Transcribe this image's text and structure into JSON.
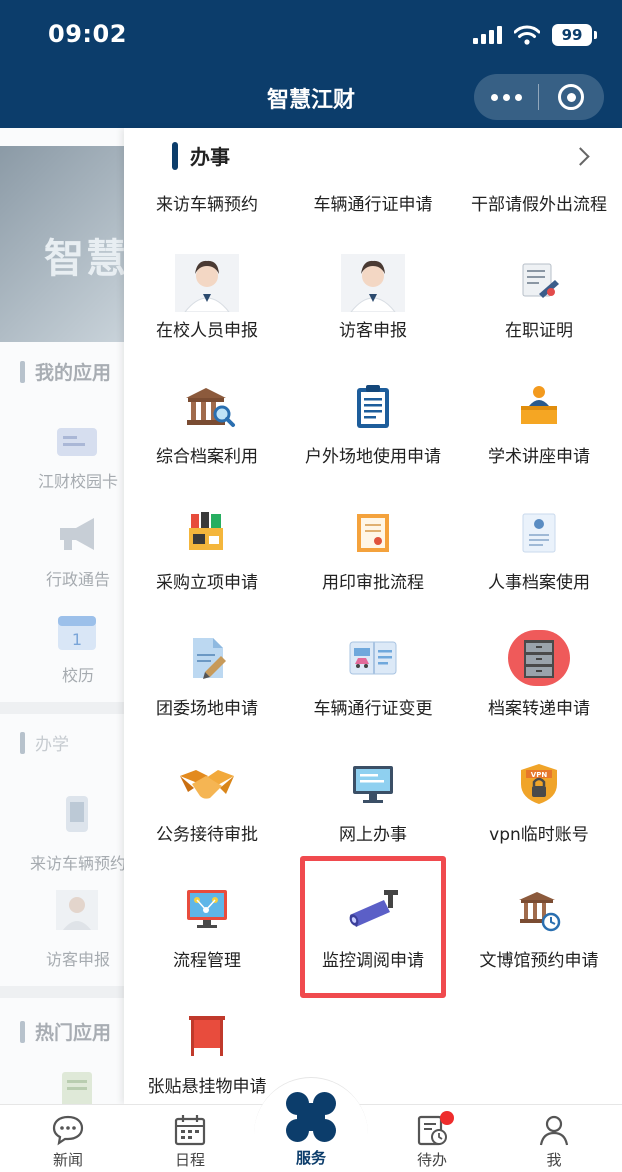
{
  "status_bar": {
    "time": "09:02",
    "battery": "99"
  },
  "app": {
    "title": "智慧江财"
  },
  "background": {
    "banner_text": "智慧",
    "section_my_apps": "我的应用",
    "my_apps": [
      {
        "label": "江财校园卡",
        "icon": "card-icon"
      },
      {
        "label": "行政通告",
        "icon": "megaphone-icon"
      },
      {
        "label": "校历",
        "icon": "calendar-icon"
      }
    ],
    "section_tab_left": "办学",
    "tab_apps": [
      {
        "label": "来访车辆预约",
        "icon": "phone-car-icon"
      },
      {
        "label": "访客申报",
        "icon": "person-icon"
      }
    ],
    "section_hot_apps": "热门应用"
  },
  "panel": {
    "title": "办事",
    "top_row": [
      "来访车辆预约",
      "车辆通行证申请",
      "干部请假外出流程"
    ],
    "items": [
      {
        "label": "在校人员申报",
        "icon": "person-photo-icon"
      },
      {
        "label": "访客申报",
        "icon": "person-photo-icon"
      },
      {
        "label": "在职证明",
        "icon": "certificate-pen-icon"
      },
      {
        "label": "综合档案利用",
        "icon": "archive-search-icon"
      },
      {
        "label": "户外场地使用申请",
        "icon": "clipboard-icon"
      },
      {
        "label": "学术讲座申请",
        "icon": "lecture-icon"
      },
      {
        "label": "采购立项申请",
        "icon": "purchase-icon"
      },
      {
        "label": "用印审批流程",
        "icon": "seal-document-icon"
      },
      {
        "label": "人事档案使用",
        "icon": "personnel-file-icon"
      },
      {
        "label": "团委场地申请",
        "icon": "document-edit-icon"
      },
      {
        "label": "车辆通行证变更",
        "icon": "vehicle-pass-icon"
      },
      {
        "label": "档案转递申请",
        "icon": "file-cabinet-icon"
      },
      {
        "label": "公务接待审批",
        "icon": "handshake-icon"
      },
      {
        "label": "网上办事",
        "icon": "monitor-icon"
      },
      {
        "label": "vpn临时账号",
        "icon": "vpn-shield-icon"
      },
      {
        "label": "流程管理",
        "icon": "workflow-screen-icon"
      },
      {
        "label": "监控调阅申请",
        "icon": "camera-icon"
      },
      {
        "label": "文博馆预约申请",
        "icon": "museum-clock-icon"
      },
      {
        "label": "张贴悬挂物申请",
        "icon": "banner-flag-icon"
      }
    ]
  },
  "bottom_nav": [
    {
      "label": "新闻",
      "icon": "chat-bubble-icon"
    },
    {
      "label": "日程",
      "icon": "calendar-grid-icon"
    },
    {
      "label": "服务",
      "icon": "clover-icon"
    },
    {
      "label": "待办",
      "icon": "todo-clock-icon"
    },
    {
      "label": "我",
      "icon": "user-icon"
    }
  ],
  "colors": {
    "primary": "#0c3d6b",
    "highlight": "#f04a4e",
    "badge": "#ee2c2c"
  }
}
